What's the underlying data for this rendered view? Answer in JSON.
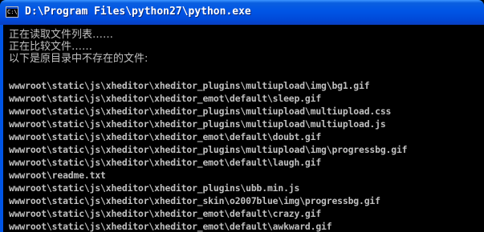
{
  "window": {
    "title": "D:\\Program Files\\python27\\python.exe",
    "icon": "console-icon",
    "icon_glyph": "C:\\"
  },
  "console": {
    "status_lines": [
      "正在读取文件列表……",
      "正在比较文件……",
      "以下是原目录中不存在的文件:"
    ],
    "file_lines": [
      "wwwroot\\static\\js\\xheditor\\xheditor_plugins\\multiupload\\img\\bg1.gif",
      "wwwroot\\static\\js\\xheditor\\xheditor_emot\\default\\sleep.gif",
      "wwwroot\\static\\js\\xheditor\\xheditor_plugins\\multiupload\\multiupload.css",
      "wwwroot\\static\\js\\xheditor\\xheditor_plugins\\multiupload\\multiupload.js",
      "wwwroot\\static\\js\\xheditor\\xheditor_emot\\default\\doubt.gif",
      "wwwroot\\static\\js\\xheditor\\xheditor_plugins\\multiupload\\img\\progressbg.gif",
      "wwwroot\\static\\js\\xheditor\\xheditor_emot\\default\\laugh.gif",
      "wwwroot\\readme.txt",
      "wwwroot\\static\\js\\xheditor\\xheditor_plugins\\ubb.min.js",
      "wwwroot\\static\\js\\xheditor\\xheditor_skin\\o2007blue\\img\\progressbg.gif",
      "wwwroot\\static\\js\\xheditor\\xheditor_emot\\default\\crazy.gif",
      "wwwroot\\static\\js\\xheditor\\xheditor_emot\\default\\awkward.gif"
    ]
  },
  "colors": {
    "titlebar": "#0055e5",
    "console_bg": "#000000",
    "console_text": "#c0c0c0"
  }
}
